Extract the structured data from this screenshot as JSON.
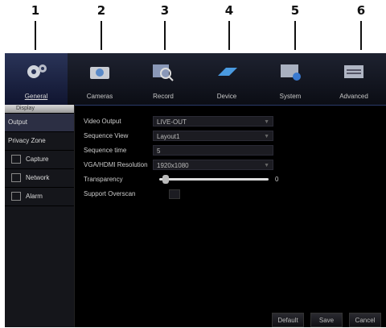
{
  "callouts": [
    "1",
    "2",
    "3",
    "4",
    "5",
    "6"
  ],
  "tabs": [
    {
      "label": "General"
    },
    {
      "label": "Cameras"
    },
    {
      "label": "Record"
    },
    {
      "label": "Device"
    },
    {
      "label": "System"
    },
    {
      "label": "Advanced"
    }
  ],
  "sidebar": {
    "header": "Display",
    "items": [
      {
        "label": "Output"
      },
      {
        "label": "Privacy Zone"
      },
      {
        "label": "Capture"
      },
      {
        "label": "Network"
      },
      {
        "label": "Alarm"
      }
    ]
  },
  "form": {
    "video_output": {
      "label": "Video Output",
      "value": "LIVE-OUT"
    },
    "sequence_view": {
      "label": "Sequence View",
      "value": "Layout1"
    },
    "sequence_time": {
      "label": "Sequence time",
      "value": "5"
    },
    "resolution": {
      "label": "VGA/HDMI Resolution",
      "value": "1920x1080"
    },
    "transparency": {
      "label": "Transparency",
      "value": "0"
    },
    "support_overscan": {
      "label": "Support Overscan"
    }
  },
  "buttons": {
    "default": "Default",
    "save": "Save",
    "cancel": "Cancel"
  }
}
